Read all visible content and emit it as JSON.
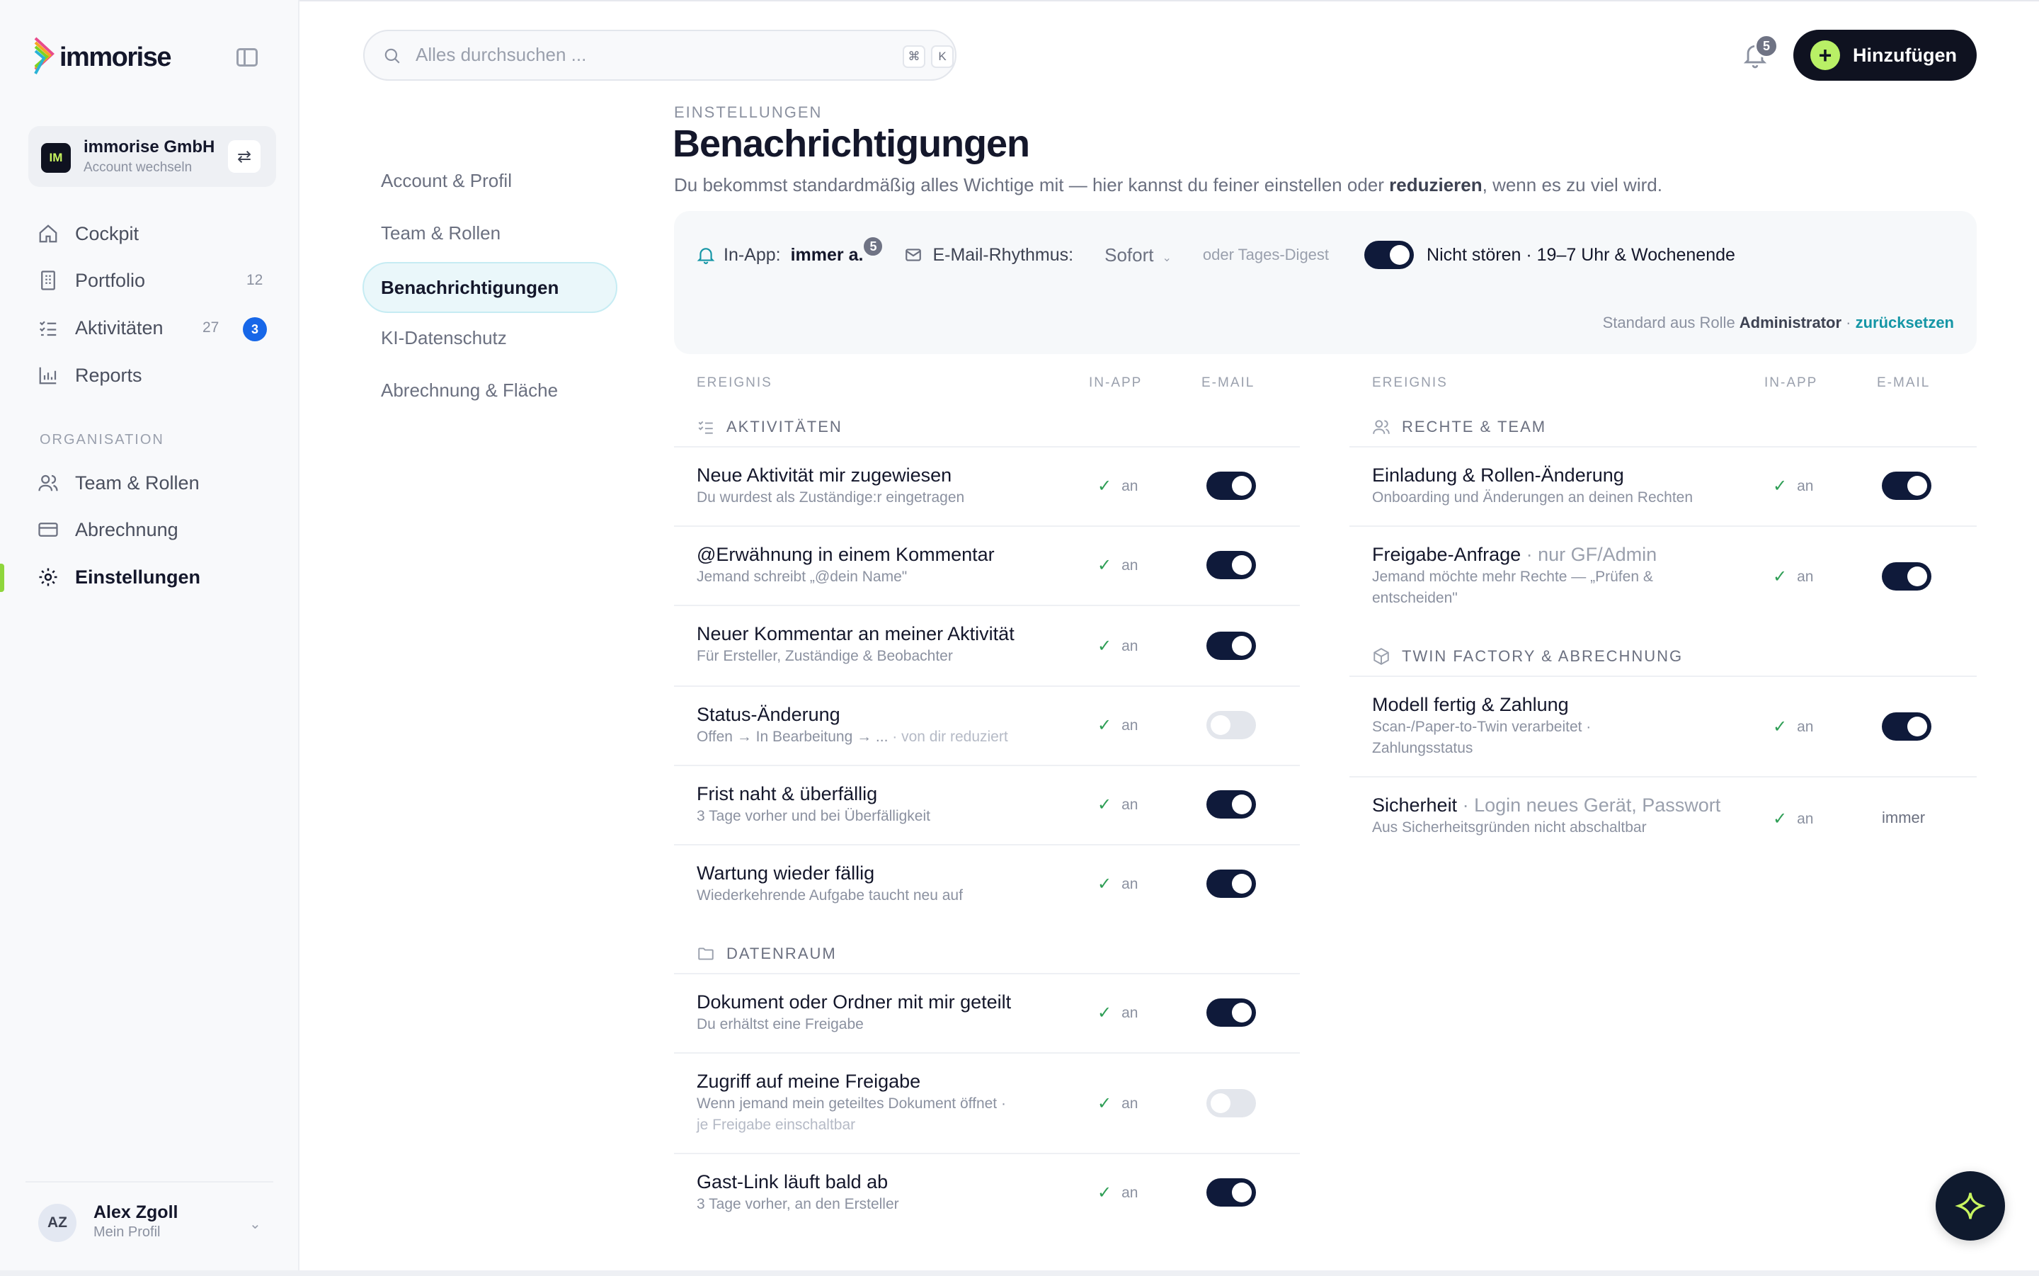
{
  "brand": {
    "name": "immorise"
  },
  "account": {
    "initials": "IM",
    "name": "immorise GmbH",
    "sub": "Account wechseln"
  },
  "nav": {
    "cockpit": "Cockpit",
    "portfolio": "Portfolio",
    "portfolio_count": "12",
    "activities": "Aktivitäten",
    "activities_count": "27",
    "activities_badge": "3",
    "reports": "Reports",
    "section": "ORGANISATION",
    "team": "Team & Rollen",
    "billing": "Abrechnung",
    "settings": "Einstellungen"
  },
  "user": {
    "initials": "AZ",
    "name": "Alex Zgoll",
    "sub": "Mein Profil"
  },
  "search": {
    "placeholder": "Alles durchsuchen ...",
    "kbd1": "⌘",
    "kbd2": "K"
  },
  "notifications": {
    "count": "5"
  },
  "add_button": {
    "label": "Hinzufügen"
  },
  "subnav": {
    "items": [
      "Account & Profil",
      "Team & Rollen",
      "Benachrichtigungen",
      "KI-Datenschutz",
      "Abrechnung & Fläche"
    ],
    "active": "Benachrichtigungen"
  },
  "header": {
    "eyebrow": "EINSTELLUNGEN",
    "title": "Benachrichtigungen",
    "desc_pre": "Du bekommst standardmäßig alles Wichtige mit — hier kannst du feiner einstellen oder ",
    "desc_bold": "reduzieren",
    "desc_post": ", wenn es zu viel wird."
  },
  "prefs": {
    "inapp_label": "In-App:",
    "inapp_value": "immer a.",
    "inapp_badge": "5",
    "mail_label": "E-Mail-Rhythmus:",
    "mail_value": "Sofort",
    "digest": "oder Tages-Digest",
    "dnd_on": true,
    "dnd_label": "Nicht stören · 19–7 Uhr & Wochenende",
    "role_pre": "Standard aus Rolle ",
    "role": "Administrator",
    "role_sep": " · ",
    "reset": "zurücksetzen"
  },
  "table_headers": {
    "event": "EREIGNIS",
    "inapp": "IN-APP",
    "email": "E-MAIL"
  },
  "left_groups": [
    {
      "title": "AKTIVITÄTEN",
      "rows": [
        {
          "title": "Neue Aktivität mir zugewiesen",
          "sub": "Du wurdest als Zuständige:r eingetragen",
          "inapp": "an",
          "email": true
        },
        {
          "title": "@Erwähnung in einem Kommentar",
          "sub": "Jemand schreibt „@dein Name\"",
          "inapp": "an",
          "email": true
        },
        {
          "title": "Neuer Kommentar an meiner Aktivität",
          "sub": "Für Ersteller, Zuständige & Beobachter",
          "inapp": "an",
          "email": true
        },
        {
          "title": "Status-Änderung",
          "sub": "Offen → In Bearbeitung → ...",
          "sub_muted": " · von dir reduziert",
          "inapp": "an",
          "email": false
        },
        {
          "title": "Frist naht & überfällig",
          "sub": "3 Tage vorher und bei Überfälligkeit",
          "inapp": "an",
          "email": true
        },
        {
          "title": "Wartung wieder fällig",
          "sub": "Wiederkehrende Aufgabe taucht neu auf",
          "inapp": "an",
          "email": true
        }
      ]
    },
    {
      "title": "DATENRAUM",
      "rows": [
        {
          "title": "Dokument oder Ordner mit mir geteilt",
          "sub": "Du erhältst eine Freigabe",
          "inapp": "an",
          "email": true
        },
        {
          "title": "Zugriff auf meine Freigabe",
          "sub": "Wenn jemand mein geteiltes Dokument öffnet ·",
          "sub2": "je Freigabe einschaltbar",
          "inapp": "an",
          "email": false
        },
        {
          "title": "Gast-Link läuft bald ab",
          "sub": "3 Tage vorher, an den Ersteller",
          "inapp": "an",
          "email": true
        }
      ]
    }
  ],
  "right_groups": [
    {
      "title": "RECHTE & TEAM",
      "rows": [
        {
          "title": "Einladung & Rollen-Änderung",
          "sub": "Onboarding und Änderungen an deinen Rechten",
          "inapp": "an",
          "email": true
        },
        {
          "title": "Freigabe-Anfrage",
          "title_muted": " · nur GF/Admin",
          "sub": "Jemand möchte mehr Rechte — „Prüfen &",
          "sub2": "entscheiden\"",
          "inapp": "an",
          "email": true
        }
      ]
    },
    {
      "title": "TWIN FACTORY & ABRECHNUNG",
      "rows": [
        {
          "title": "Modell fertig & Zahlung",
          "sub": "Scan-/Paper-to-Twin verarbeitet ·",
          "sub2": "Zahlungsstatus",
          "inapp": "an",
          "email": true
        },
        {
          "title": "Sicherheit",
          "title_muted": " · Login neues Gerät, Passwort",
          "sub": "Aus Sicherheitsgründen nicht abschaltbar",
          "inapp": "an",
          "email_text": "immer"
        }
      ]
    }
  ],
  "colors": {
    "accent": "#b9f066",
    "dark": "#0f1220",
    "link": "#1596a6",
    "badge": "#1767e8",
    "check": "#2e9e55"
  }
}
